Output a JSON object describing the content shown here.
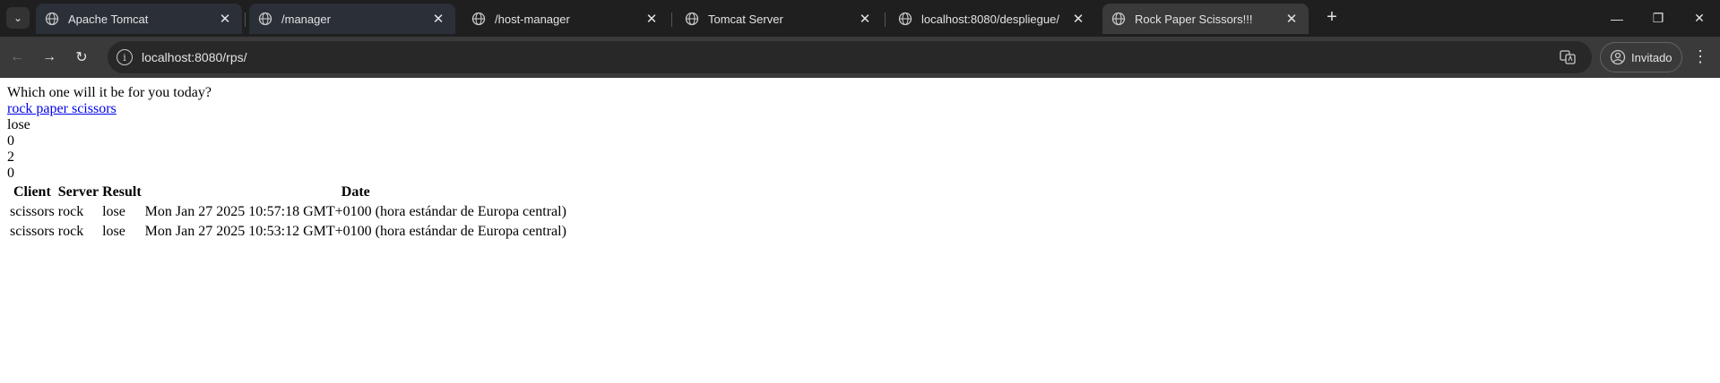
{
  "browser": {
    "tabs": [
      {
        "title": "Apache Tomcat"
      },
      {
        "title": "/manager"
      },
      {
        "title": "/host-manager"
      },
      {
        "title": "Tomcat Server"
      },
      {
        "title": "localhost:8080/despliegue/"
      },
      {
        "title": "Rock Paper Scissors!!!"
      }
    ],
    "active_tab_index": 5,
    "url": "localhost:8080/rps/",
    "profile_label": "Invitado"
  },
  "page": {
    "prompt": "Which one will it be for you today?",
    "link_text": "rock paper scissors",
    "result": "lose",
    "score_a": "0",
    "score_b": "2",
    "score_c": "0",
    "table_headers": [
      "Client",
      "Server",
      "Result",
      "Date"
    ],
    "rows": [
      [
        "scissors",
        "rock",
        "lose",
        "Mon Jan 27 2025 10:57:18 GMT+0100 (hora estándar de Europa central)"
      ],
      [
        "scissors",
        "rock",
        "lose",
        "Mon Jan 27 2025 10:53:12 GMT+0100 (hora estándar de Europa central)"
      ]
    ]
  }
}
